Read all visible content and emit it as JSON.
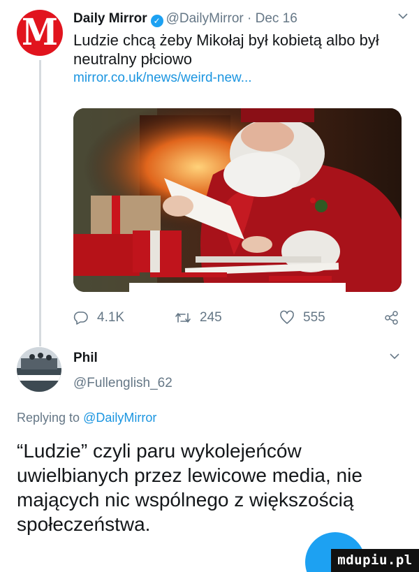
{
  "tweet": {
    "avatar_letter": "M",
    "author_name": "Daily Mirror",
    "handle": "@DailyMirror",
    "separator": "·",
    "date": "Dec 16",
    "text": "Ludzie chcą żeby Mikołaj był kobietą albo był neutralny płciowo",
    "link": "mirror.co.uk/news/weird-new...",
    "stats": {
      "replies": "4.1K",
      "retweets": "245",
      "likes": "555"
    }
  },
  "reply": {
    "author_name": "Phil",
    "handle": "@Fullenglish_62",
    "replying_prefix": "Replying to",
    "replying_to": "@DailyMirror",
    "text": "“Ludzie” czyli paru wykolejeńców uwielbianych przez lewicowe media, nie mających nic wspólnego z większością społeczeństwa."
  },
  "watermark": "mdupiu.pl",
  "icons": {
    "verified": "verified-badge-icon",
    "menu": "chevron-down-icon",
    "reply": "reply-bubble-icon",
    "retweet": "retweet-icon",
    "like": "heart-icon",
    "share": "share-icon"
  },
  "colors": {
    "accent": "#1da1f2",
    "link": "#1b95e0",
    "muted": "#657786",
    "text": "#14171a",
    "brand_red": "#e1141e"
  }
}
